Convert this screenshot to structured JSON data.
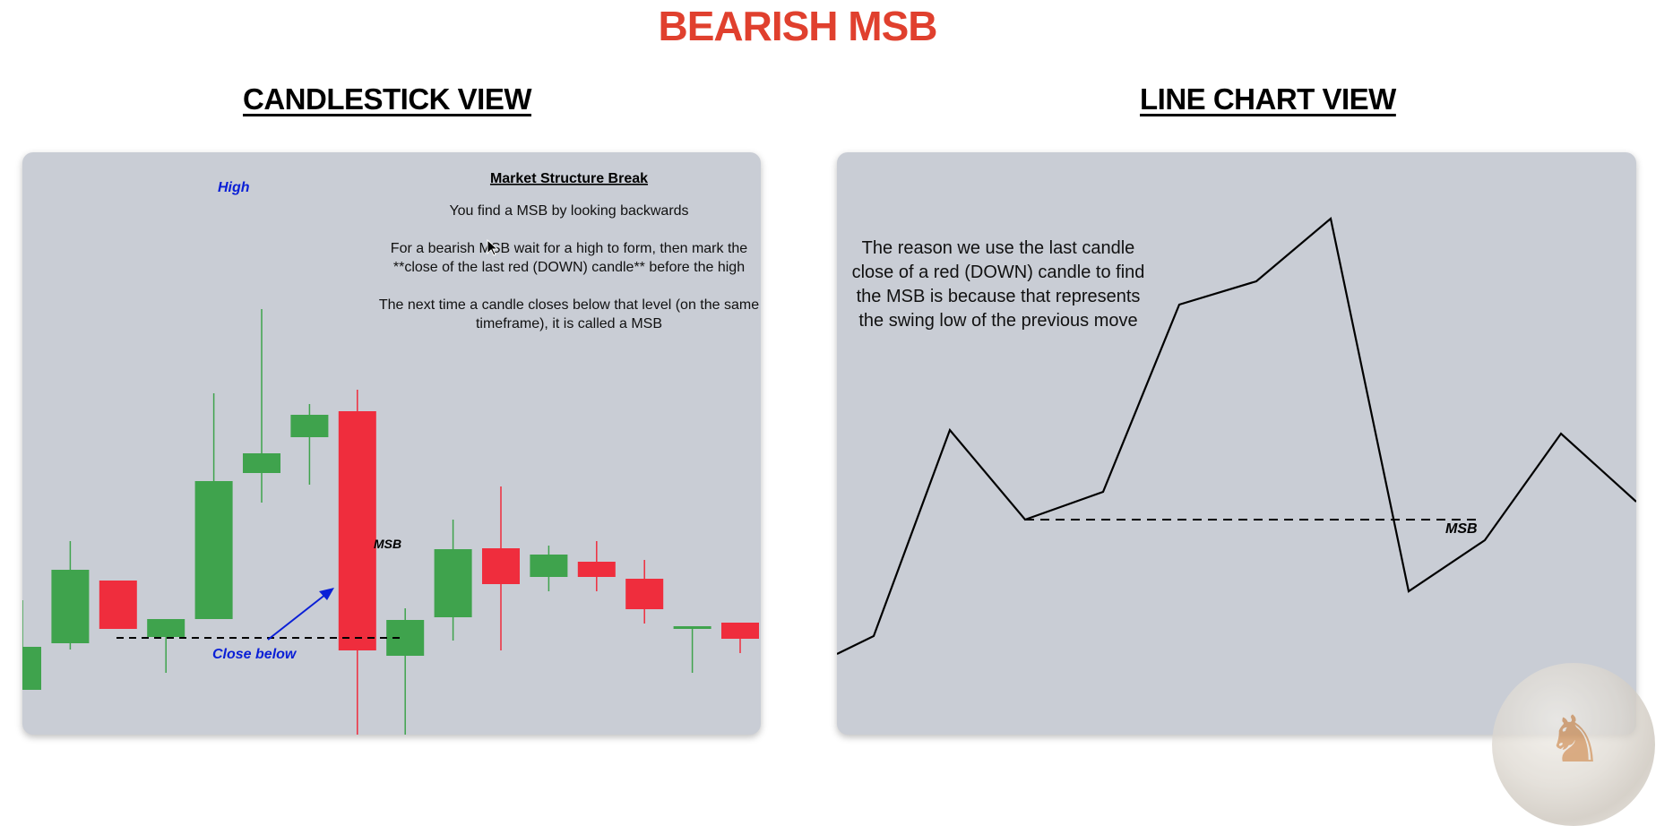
{
  "title": "BEARISH MSB",
  "candlestick_view": {
    "heading": "CANDLESTICK VIEW",
    "info_title": "Market Structure Break",
    "info_lines": [
      "You find a MSB by looking backwards",
      "For a bearish MSB wait for a high to form, then mark the",
      "**close of the last red (DOWN) candle** before the high",
      "The next time a candle closes below that level (on the same",
      "timeframe), it is called a MSB"
    ],
    "label_high": "High",
    "label_msb": "MSB",
    "label_close_below": "Close below"
  },
  "line_chart_view": {
    "heading": "LINE CHART VIEW",
    "note_lines": [
      "The reason we use the last candle",
      "close of a red (DOWN) candle to find",
      "the MSB is because that represents",
      "the swing low of the previous move"
    ],
    "label_msb": "MSB"
  },
  "colors": {
    "title": "#e0402e",
    "bull": "#3fa34d",
    "bear": "#ef2d3d",
    "panel": "#c9cdd5",
    "annotation": "#0a1fd6"
  },
  "chart_data": [
    {
      "type": "candlestick",
      "title": "CANDLESTICK VIEW",
      "msb_level": 108,
      "candles": [
        {
          "open": 50,
          "close": 98,
          "high": 150,
          "low": 74,
          "dir": "up"
        },
        {
          "open": 102,
          "close": 184,
          "high": 216,
          "low": 95,
          "dir": "up"
        },
        {
          "open": 172,
          "close": 118,
          "high": 159,
          "low": 145,
          "dir": "down"
        },
        {
          "open": 109,
          "close": 129,
          "high": 109,
          "low": 69,
          "dir": "up"
        },
        {
          "open": 129,
          "close": 283,
          "high": 381,
          "low": 129,
          "dir": "up"
        },
        {
          "open": 292,
          "close": 314,
          "high": 475,
          "low": 259,
          "dir": "up"
        },
        {
          "open": 332,
          "close": 357,
          "high": 369,
          "low": 279,
          "dir": "up"
        },
        {
          "open": 361,
          "close": 94,
          "high": 385,
          "low": 0,
          "dir": "down"
        },
        {
          "open": 88,
          "close": 128,
          "high": 141,
          "low": 0,
          "dir": "up"
        },
        {
          "open": 131,
          "close": 207,
          "high": 240,
          "low": 105,
          "dir": "up"
        },
        {
          "open": 208,
          "close": 168,
          "high": 277,
          "low": 94,
          "dir": "down"
        },
        {
          "open": 176,
          "close": 201,
          "high": 211,
          "low": 160,
          "dir": "up"
        },
        {
          "open": 193,
          "close": 176,
          "high": 216,
          "low": 160,
          "dir": "down"
        },
        {
          "open": 174,
          "close": 140,
          "high": 195,
          "low": 124,
          "dir": "down"
        },
        {
          "open": 121,
          "close": 118,
          "high": 121,
          "low": 69,
          "dir": "up"
        },
        {
          "open": 125,
          "close": 107,
          "high": 125,
          "low": 91,
          "dir": "down"
        }
      ]
    },
    {
      "type": "line",
      "title": "LINE CHART VIEW",
      "msb_level": 240,
      "y": [
        90,
        110,
        340,
        240,
        271,
        480,
        506,
        576,
        160,
        217,
        336,
        260
      ]
    }
  ]
}
